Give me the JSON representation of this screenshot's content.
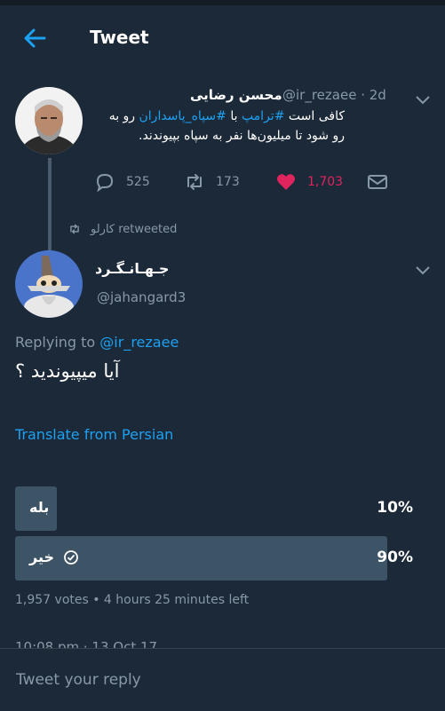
{
  "header": {
    "title": "Tweet"
  },
  "original_tweet": {
    "author_name": "محسن رضایی",
    "handle_time": "@ir_rezaee · 2d",
    "text_before": "کافی است ",
    "hashtag1": "#ترامپ",
    "text_mid": " با ",
    "hashtag2": "#سپاه_پاسداران",
    "text_after": " رو به رو شود تا میلیون‌ها نفر  به سپاه بپیوندند.",
    "replies": "525",
    "retweets": "173",
    "likes": "1,703"
  },
  "retweet_info": {
    "text": "کارلو retweeted"
  },
  "reply_tweet": {
    "author_name": "جـهـانـگـرد",
    "handle": "@jahangard3",
    "replying_prefix": "Replying to ",
    "replying_handle": "@ir_rezaee",
    "text": "آیا میپیوندید ؟",
    "translate": "Translate from Persian"
  },
  "poll": {
    "options": [
      {
        "label": "بله",
        "percent_text": "10%",
        "fraction": 0.1,
        "selected": false
      },
      {
        "label": "خیر",
        "percent_text": "90%",
        "fraction": 0.9,
        "selected": true
      }
    ],
    "summary": "1,957 votes • 4 hours 25 minutes left"
  },
  "timestamp": "10:08 pm · 13 Oct 17",
  "reply_box": {
    "placeholder": "Tweet your reply"
  },
  "colors": {
    "accent": "#1da1f2",
    "like": "#e0245e",
    "background": "#10171e",
    "panel": "#1c2938",
    "muted": "#8899a6"
  }
}
